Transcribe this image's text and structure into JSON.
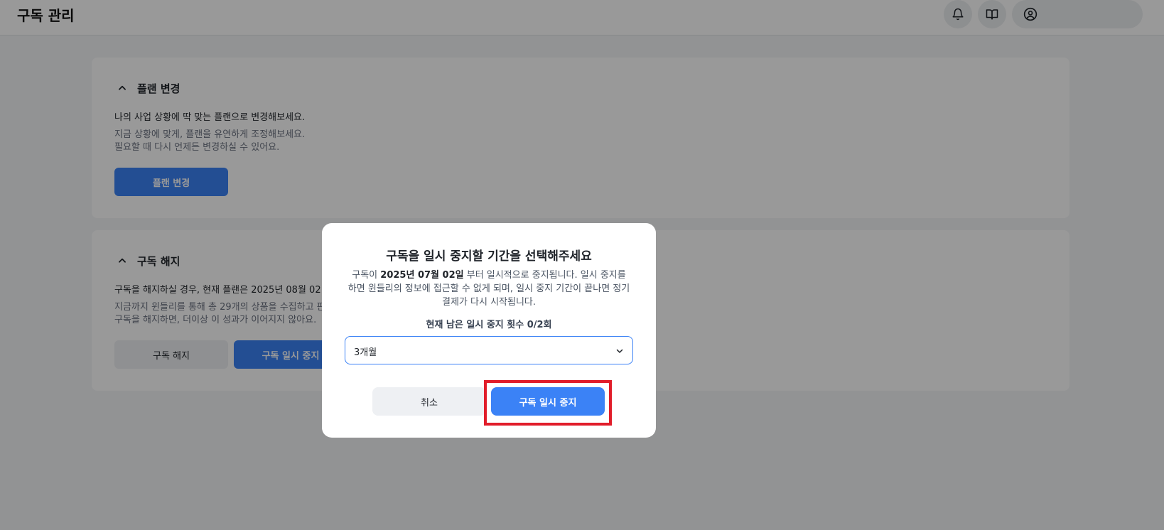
{
  "header": {
    "title": "구독 관리",
    "icons": [
      "bell-icon",
      "book-icon",
      "user-circle-icon"
    ]
  },
  "plan_card": {
    "title": "플랜 변경",
    "headline": "나의 사업 상황에 딱 맞는 플랜으로 변경해보세요.",
    "line1": "지금 상황에 맞게, 플랜을 유연하게 조정해보세요.",
    "line2": "필요할 때 다시 언제든 변경하실 수 있어요.",
    "button": "플랜 변경"
  },
  "cancel_card": {
    "title": "구독 해지",
    "headline": "구독을 해지하실 경우, 현재 플랜은 2025년 08월 02",
    "line1": "지금까지 윈들리를 통해 총 29개의 상품을 수집하고 판",
    "line2": "구독을 해지하면, 더이상 이 성과가 이어지지 않아요.",
    "cancel_button": "구독 해지",
    "pause_button": "구독 일시 중지"
  },
  "modal": {
    "title": "구독을 일시 중지할 기간을 선택해주세요",
    "desc_prefix": "구독이",
    "desc_date": "2025년 07월 02일",
    "desc_suffix": "부터 일시적으로 중지됩니다. 일시 중지를 하면 윈들리의 정보에 접근할 수 없게 되며, 일시 중지 기간이 끝나면 정기 결제가 다시 시작됩니다.",
    "remaining": "현재 남은 일시 중지 횟수 0/2회",
    "select_value": "3개월",
    "cancel_label": "취소",
    "confirm_label": "구독 일시 중지"
  },
  "colors": {
    "accent": "#3b82f6",
    "highlight": "#e11d2a",
    "overlay": "rgba(0,0,0,0.4)"
  }
}
